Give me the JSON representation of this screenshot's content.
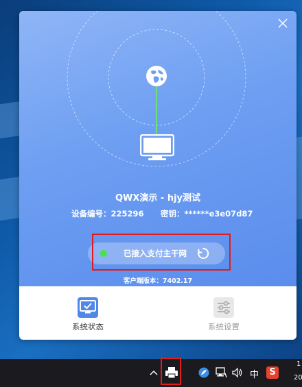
{
  "panel": {
    "title": "QWX演示 - hjy测试",
    "device_label": "设备编号：",
    "device_id": "225296",
    "key_label": "密钥：",
    "key_value": "******e3e07d87",
    "status_text": "已接入支付主干网",
    "version_label": "客户端版本：",
    "version_value": "7402.17",
    "tabs": [
      {
        "label": "系统状态",
        "icon": "monitor-check-icon",
        "active": true
      },
      {
        "label": "系统设置",
        "icon": "sliders-icon",
        "active": false
      }
    ]
  },
  "taskbar": {
    "ime": "中",
    "clock_line1": "1",
    "clock_line2": "20"
  },
  "colors": {
    "hero_top": "#8fb5f6",
    "hero_bottom": "#5a8ded",
    "status_green": "#47e34d",
    "active_tab_text": "#333333",
    "inactive_tab_text": "#9a9a9a",
    "highlight_red": "#e01c1c"
  }
}
